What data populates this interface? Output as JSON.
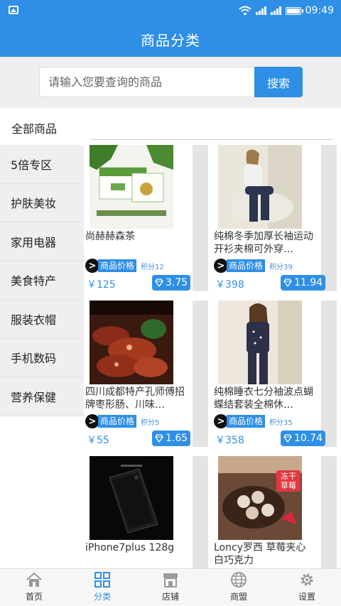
{
  "status_bar": {
    "time": "09:49"
  },
  "header": {
    "title": "商品分类"
  },
  "search": {
    "placeholder": "请输入您要查询的商品",
    "button_label": "搜索"
  },
  "category_header": {
    "label": "全部商品"
  },
  "sidebar": {
    "items": [
      {
        "label": "5倍专区"
      },
      {
        "label": "护肤美妆"
      },
      {
        "label": "家用电器"
      },
      {
        "label": "美食特产"
      },
      {
        "label": "服装衣帽"
      },
      {
        "label": "手机数码"
      },
      {
        "label": "营养保健"
      }
    ]
  },
  "products": [
    {
      "name": "尚赫赫森茶",
      "tag": "商品价格",
      "points": "积分12",
      "price": "￥125",
      "gem": "3.75",
      "image": "tea-box"
    },
    {
      "name": "纯棉冬季加厚长袖运动开衫夹棉可外穿…",
      "tag": "商品价格",
      "points": "积分39",
      "price": "￥398",
      "gem": "11.94",
      "image": "woman-sitting"
    },
    {
      "name": "四川成都特产孔师傅招牌枣形肠、川味…",
      "tag": "商品价格",
      "points": "积分5",
      "price": "￥55",
      "gem": "1.65",
      "image": "sausage"
    },
    {
      "name": "纯棉睡衣七分袖波点蝴蝶结套装全棉休…",
      "tag": "商品价格",
      "points": "积分35",
      "price": "￥358",
      "gem": "10.74",
      "image": "woman-standing"
    },
    {
      "name": "iPhone7plus 128g",
      "image": "phone"
    },
    {
      "name": "Loncy罗西 草莓夹心白巧克力",
      "image": "chocolate",
      "image_text": "冻干草莓"
    }
  ],
  "bottom_nav": {
    "items": [
      {
        "label": "首页",
        "icon": "home-icon"
      },
      {
        "label": "分类",
        "icon": "category-icon"
      },
      {
        "label": "店铺",
        "icon": "shop-icon"
      },
      {
        "label": "商盟",
        "icon": "globe-icon"
      },
      {
        "label": "设置",
        "icon": "gear-icon"
      }
    ],
    "active_index": 1
  },
  "colors": {
    "primary": "#2f8fe6",
    "sidebar_bg": "#efefef"
  }
}
